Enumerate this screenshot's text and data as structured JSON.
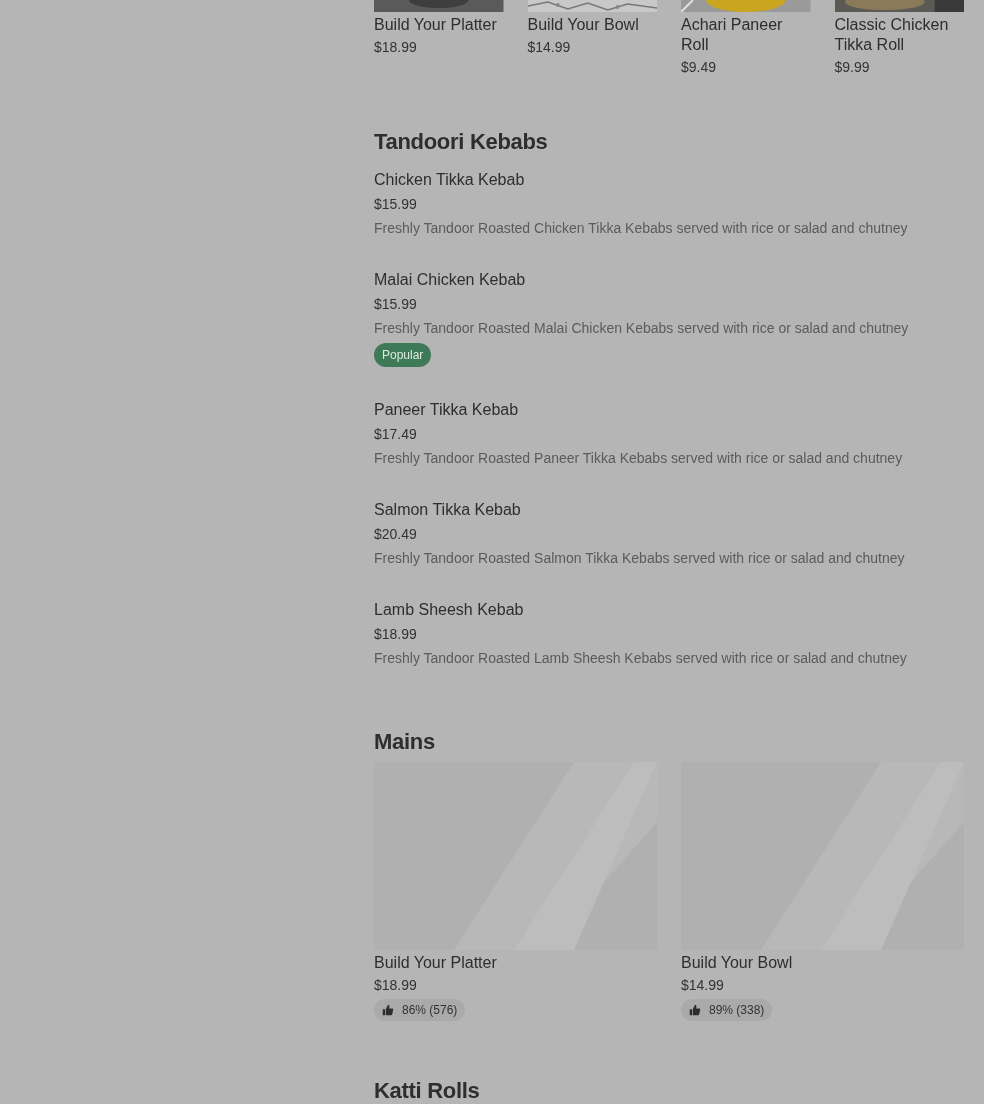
{
  "featured": [
    {
      "name": "Build Your Platter",
      "price": "$18.99",
      "kind": "picture"
    },
    {
      "name": "Build Your Bowl",
      "price": "$14.99",
      "kind": "picture"
    },
    {
      "name": "Achari Paneer Roll",
      "price": "$9.49",
      "kind": "picture"
    },
    {
      "name": "Classic Chicken Tikka Roll",
      "price": "$9.99",
      "kind": "picture"
    }
  ],
  "sections": [
    {
      "title": "Tandoori Kebabs",
      "kind": "list",
      "items": [
        {
          "name": "Chicken Tikka Kebab",
          "price": "$15.99",
          "description": "Freshly Tandoor Roasted Chicken Tikka Kebabs served with rice or salad and chutney"
        },
        {
          "name": "Malai Chicken Kebab",
          "price": "$15.99",
          "description": "Freshly Tandoor Roasted Malai Chicken Kebabs served with rice or salad and chutney",
          "badge": "Popular"
        },
        {
          "name": "Paneer Tikka Kebab",
          "price": "$17.49",
          "description": "Freshly Tandoor Roasted Paneer Tikka Kebabs served with rice or salad and chutney"
        },
        {
          "name": "Salmon Tikka Kebab",
          "price": "$20.49",
          "description": "Freshly Tandoor Roasted Salmon Tikka Kebabs served with rice or salad and chutney"
        },
        {
          "name": "Lamb Sheesh Kebab",
          "price": "$18.99",
          "description": "Freshly Tandoor Roasted Lamb Sheesh Kebabs served with rice or salad and chutney"
        }
      ]
    },
    {
      "title": "Mains",
      "kind": "grid",
      "items": [
        {
          "name": "Build Your Platter",
          "price": "$18.99",
          "rating": "86% (576)"
        },
        {
          "name": "Build Your Bowl",
          "price": "$14.99",
          "rating": "89% (338)"
        }
      ]
    },
    {
      "title": "Katti Rolls",
      "kind": "list"
    }
  ]
}
